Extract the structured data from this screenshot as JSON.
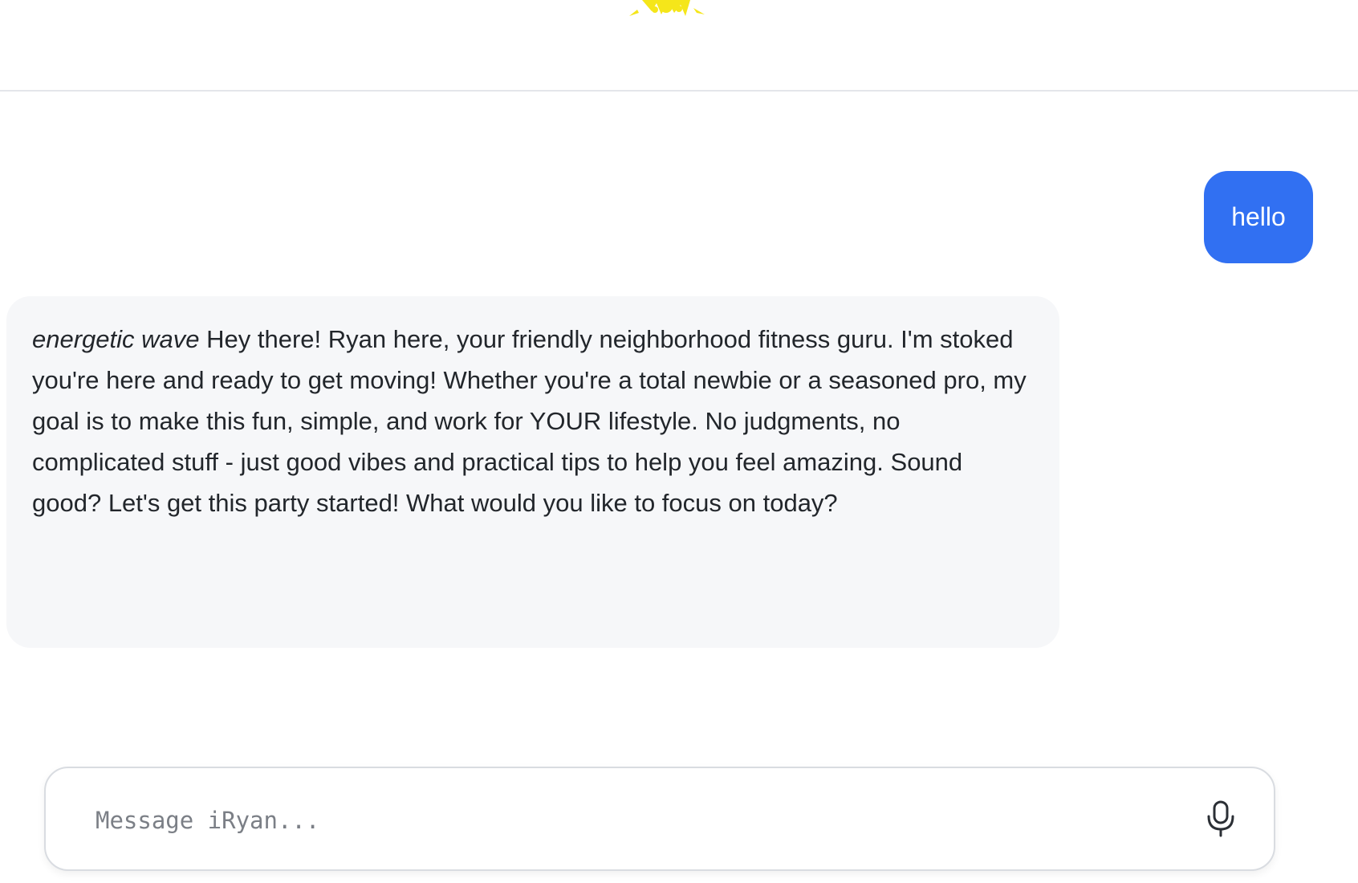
{
  "header": {
    "logo_icon": "yellow-splash-logo-icon",
    "accent": "#f5e61a"
  },
  "messages": [
    {
      "role": "user",
      "text": "hello",
      "bubble_color": "#3170f2"
    },
    {
      "role": "assistant",
      "action": "energetic wave",
      "text": " Hey there! Ryan here, your friendly neighborhood fitness guru. I'm stoked you're here and ready to get moving! Whether you're a total newbie or a seasoned pro, my goal is to make this fun, simple, and work for YOUR lifestyle. No judgments, no complicated stuff - just good vibes and practical tips to help you feel amazing. Sound good? Let's get this party started! What would you like to focus on today?",
      "bubble_color": "#f6f7f9"
    }
  ],
  "composer": {
    "placeholder": "Message iRyan...",
    "value": "",
    "mic_icon": "microphone-icon"
  }
}
